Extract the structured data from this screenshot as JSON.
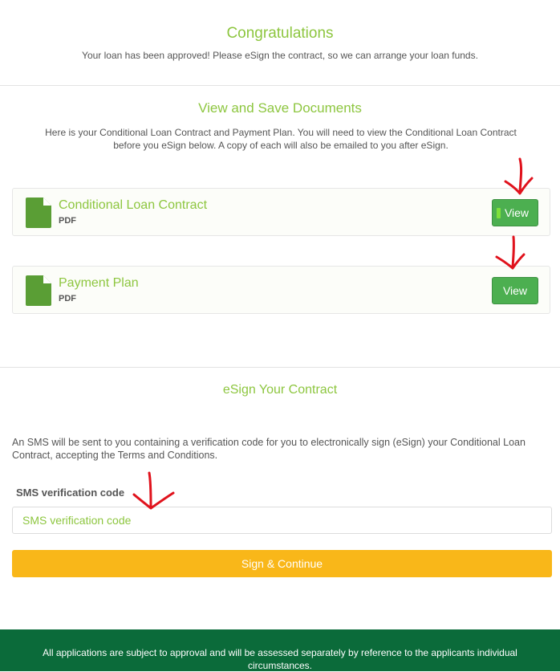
{
  "header": {
    "title": "Congratulations",
    "message": "Your loan has been approved! Please eSign the contract, so we can arrange your loan funds."
  },
  "documents_section": {
    "title": "View and Save Documents",
    "description": "Here is your Conditional Loan Contract and Payment Plan. You will need to view the Conditional Loan Contract before you eSign below. A copy of each will also be emailed to you after eSign.",
    "documents": [
      {
        "name": "Conditional Loan Contract",
        "type": "PDF",
        "button_label": "View"
      },
      {
        "name": "Payment Plan",
        "type": "PDF",
        "button_label": "View"
      }
    ]
  },
  "esign_section": {
    "title": "eSign Your Contract",
    "description": "An SMS will be sent to you containing a verification code for you to electronically sign (eSign) your Conditional Loan Contract, accepting the Terms and Conditions.",
    "sms_label": "SMS verification code",
    "sms_placeholder": "SMS verification code",
    "sms_value": "",
    "submit_label": "Sign & Continue"
  },
  "footer": {
    "text": "All applications are subject to approval and will be assessed separately by reference to the applicants individual circumstances."
  },
  "colors": {
    "accent_green": "#8dc63f",
    "button_green": "#4caf50",
    "icon_green": "#5a9e35",
    "sign_button": "#f9b719",
    "footer_bg": "#0b6b3a",
    "annotation_red": "#e0121c"
  },
  "icons": {
    "document": "file-icon",
    "annotation": "hand-drawn-arrow-icon"
  }
}
